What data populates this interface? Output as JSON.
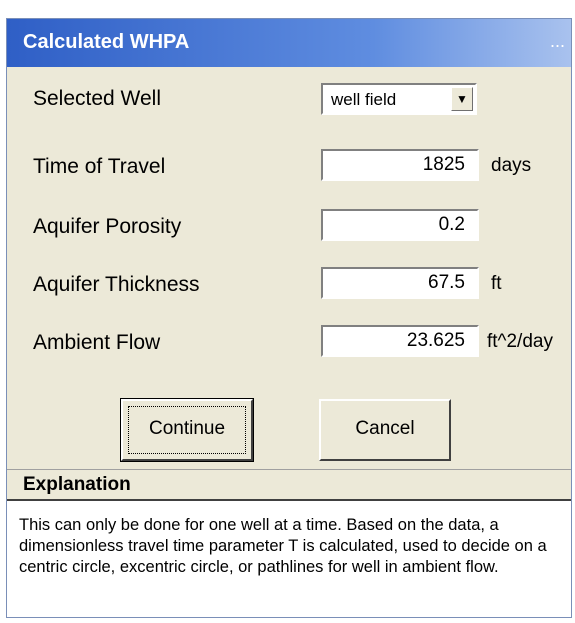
{
  "window": {
    "title": "Calculated WHPA",
    "title_dots": "..."
  },
  "selected_well": {
    "label": "Selected Well",
    "value": "well field"
  },
  "time_of_travel": {
    "label": "Time of Travel",
    "value": "1825",
    "unit": "days"
  },
  "aquifer_porosity": {
    "label": "Aquifer Porosity",
    "value": "0.2"
  },
  "aquifer_thickness": {
    "label": "Aquifer Thickness",
    "value": "67.5",
    "unit": "ft"
  },
  "ambient_flow": {
    "label": "Ambient Flow",
    "value": "23.625",
    "unit": "ft^2/day"
  },
  "buttons": {
    "continue": "Continue",
    "cancel": "Cancel"
  },
  "explanation": {
    "title": "Explanation",
    "text": "This can only be done for one well at a time. Based on the data, a dimensionless travel time parameter T is calculated, used to decide on a centric circle, excentric circle, or pathlines for well in ambient flow."
  }
}
